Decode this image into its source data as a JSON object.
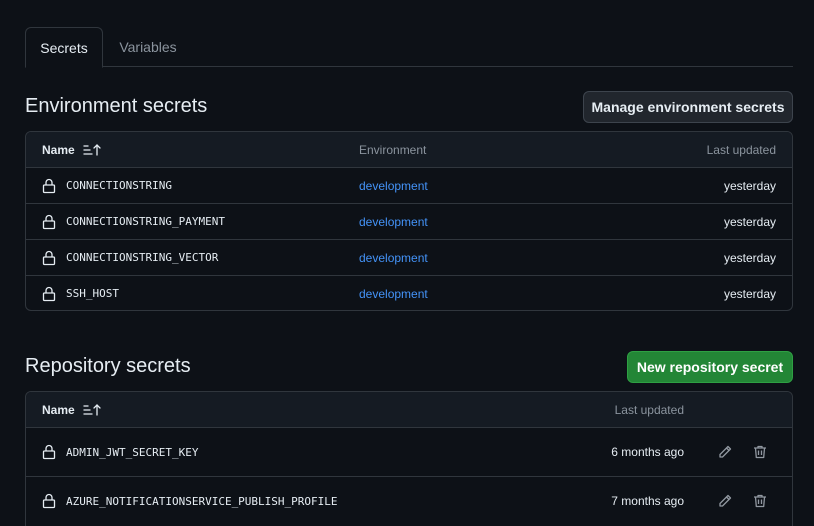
{
  "tabs": [
    {
      "label": "Secrets",
      "active": true
    },
    {
      "label": "Variables",
      "active": false
    }
  ],
  "environment_secrets": {
    "title": "Environment secrets",
    "manage_button": "Manage environment secrets",
    "columns": {
      "name": "Name",
      "environment": "Environment",
      "last_updated": "Last updated"
    },
    "rows": [
      {
        "name": "CONNECTIONSTRING",
        "environment": "development",
        "updated": "yesterday"
      },
      {
        "name": "CONNECTIONSTRING_PAYMENT",
        "environment": "development",
        "updated": "yesterday"
      },
      {
        "name": "CONNECTIONSTRING_VECTOR",
        "environment": "development",
        "updated": "yesterday"
      },
      {
        "name": "SSH_HOST",
        "environment": "development",
        "updated": "yesterday"
      }
    ]
  },
  "repository_secrets": {
    "title": "Repository secrets",
    "new_button": "New repository secret",
    "columns": {
      "name": "Name",
      "last_updated": "Last updated"
    },
    "rows": [
      {
        "name": "ADMIN_JWT_SECRET_KEY",
        "updated": "6 months ago"
      },
      {
        "name": "AZURE_NOTIFICATIONSERVICE_PUBLISH_PROFILE",
        "updated": "7 months ago"
      }
    ]
  },
  "icons": {
    "lock": "lock-icon",
    "sort": "sort-ascending-icon",
    "edit": "pencil-icon",
    "delete": "trash-icon"
  },
  "colors": {
    "background": "#0d1117",
    "link": "#4493f8",
    "primary_button": "#238636",
    "border": "#30363d"
  }
}
